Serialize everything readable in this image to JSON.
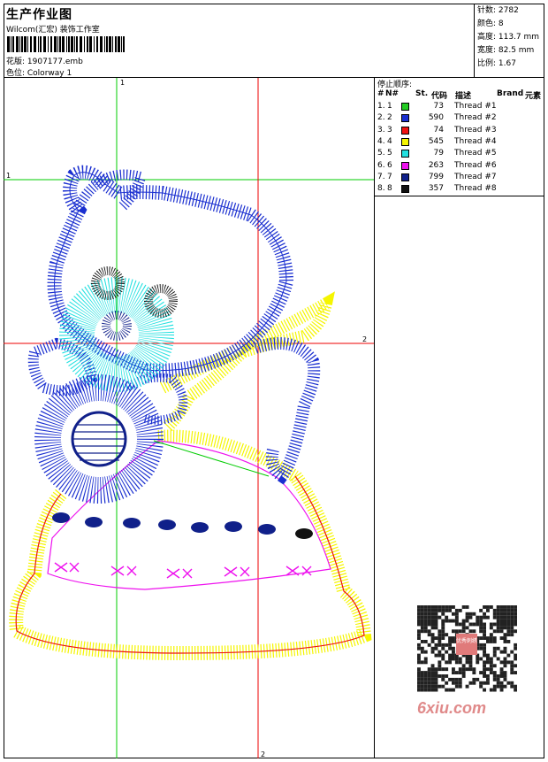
{
  "header": {
    "title": "生产作业图",
    "company": "Wilcom(汇宏) 装饰工作室",
    "design_label": "花版: 1907177.emb",
    "colorway_label": "色位: Colorway 1"
  },
  "stats": {
    "stitches": "针数: 2782",
    "colors": "颜色: 8",
    "height": "高度: 113.7 mm",
    "width": "宽度: 82.5 mm",
    "scale": "比例: 1.67"
  },
  "stop_sequence": {
    "title": "停止顺序:",
    "columns": {
      "num": "#",
      "no": "N#",
      "st": "St.",
      "code": "代码",
      "desc": "描述",
      "brand": "Brand",
      "element": "元素"
    },
    "rows": [
      {
        "num": "1.",
        "no": "1",
        "color": "#22cc22",
        "code": "73",
        "desc": "Thread #1"
      },
      {
        "num": "2.",
        "no": "2",
        "color": "#1a2fd0",
        "code": "590",
        "desc": "Thread #2"
      },
      {
        "num": "3.",
        "no": "3",
        "color": "#ee1111",
        "code": "74",
        "desc": "Thread #3"
      },
      {
        "num": "4.",
        "no": "4",
        "color": "#f5f500",
        "code": "545",
        "desc": "Thread #4"
      },
      {
        "num": "5.",
        "no": "5",
        "color": "#22e0e0",
        "code": "79",
        "desc": "Thread #5"
      },
      {
        "num": "6.",
        "no": "6",
        "color": "#ee11ee",
        "code": "263",
        "desc": "Thread #6"
      },
      {
        "num": "7.",
        "no": "7",
        "color": "#10208a",
        "code": "799",
        "desc": "Thread #7"
      },
      {
        "num": "8.",
        "no": "8",
        "color": "#111111",
        "code": "357",
        "desc": "Thread #8"
      }
    ]
  },
  "canvas": {
    "guide_v_green": "1",
    "guide_h_green": "1",
    "guide_h_red": "2",
    "guide_v_red": "2"
  },
  "watermark": {
    "text": "6xiu.com",
    "qr_badge": "优秀刺绣"
  }
}
